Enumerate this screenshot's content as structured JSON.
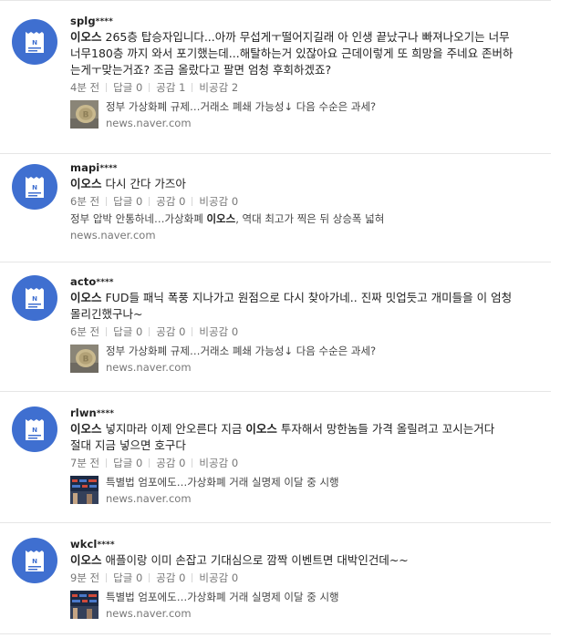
{
  "comments": [
    {
      "user": "splg",
      "mask": "****",
      "segments": [
        {
          "text": "이오스",
          "bold": true
        },
        {
          "text": " 265층 탑승자입니다...아까 무섭게ㅜ떨어지길래 아 인생 끝났구나 빠져나오기는 너무\n너무180층 까지 와서 포기했는데...해탈하는거 있잖아요 근데이렇게 또 희망을 주네요 존버하\n는게ㅜ맞는거죠? 조금 올랐다고 팔면 엄청 후회하겠죠?",
          "bold": false
        }
      ],
      "meta": [
        "4분 전",
        "답글 0",
        "공감 1",
        "비공감 2"
      ],
      "link": {
        "thumb": "bitcoin-coin",
        "title_segments": [
          {
            "text": "정부 가상화폐 규제…거래소 폐쇄 가능성↓ 다음 수순은 과세?",
            "bold": false
          }
        ],
        "source": "news.naver.com"
      }
    },
    {
      "user": "mapi",
      "mask": "****",
      "segments": [
        {
          "text": "이오스",
          "bold": true
        },
        {
          "text": " 다시 간다 가즈아",
          "bold": false
        }
      ],
      "meta": [
        "6분 전",
        "답글 0",
        "공감 0",
        "비공감 0"
      ],
      "link": {
        "thumb": "",
        "title_segments": [
          {
            "text": "정부 압박 안통하네…가상화폐 ",
            "bold": false
          },
          {
            "text": "이오스",
            "bold": true
          },
          {
            "text": ", 역대 최고가 찍은 뒤 상승폭 넓혀",
            "bold": false
          }
        ],
        "source": "news.naver.com"
      }
    },
    {
      "user": "acto",
      "mask": "****",
      "segments": [
        {
          "text": "이오스",
          "bold": true
        },
        {
          "text": " FUD들 패닉 폭풍 지나가고 원점으로 다시 찾아가네.. 진짜 밋업듯고 개미들을 이 엄청\n몰리긴했구나~",
          "bold": false
        }
      ],
      "meta": [
        "6분 전",
        "답글 0",
        "공감 0",
        "비공감 0"
      ],
      "link": {
        "thumb": "bitcoin-coin",
        "title_segments": [
          {
            "text": "정부 가상화폐 규제…거래소 폐쇄 가능성↓ 다음 수순은 과세?",
            "bold": false
          }
        ],
        "source": "news.naver.com"
      }
    },
    {
      "user": "rlwn",
      "mask": "****",
      "segments": [
        {
          "text": "이오스",
          "bold": true
        },
        {
          "text": " 넣지마라 이제 안오른다 지금 ",
          "bold": false
        },
        {
          "text": "이오스",
          "bold": true
        },
        {
          "text": " 투자해서 망한놈들 가격 올릴려고 꼬시는거다\n절대 지금 넣으면 호구다",
          "bold": false
        }
      ],
      "meta": [
        "7분 전",
        "답글 0",
        "공감 0",
        "비공감 0"
      ],
      "link": {
        "thumb": "trading-screen",
        "title_segments": [
          {
            "text": "특별법 엄포에도…가상화폐 거래 실명제 이달 중 시행",
            "bold": false
          }
        ],
        "source": "news.naver.com"
      }
    },
    {
      "user": "wkcl",
      "mask": "****",
      "segments": [
        {
          "text": "이오스",
          "bold": true
        },
        {
          "text": " 애플이랑 이미 손잡고 기대심으로 깜짝 이벤트면 대박인건데~~",
          "bold": false
        }
      ],
      "meta": [
        "9분 전",
        "답글 0",
        "공감 0",
        "비공감 0"
      ],
      "link": {
        "thumb": "trading-screen",
        "title_segments": [
          {
            "text": "특별법 엄포에도…가상화폐 거래 실명제 이달 중 시행",
            "bold": false
          }
        ],
        "source": "news.naver.com"
      }
    }
  ]
}
